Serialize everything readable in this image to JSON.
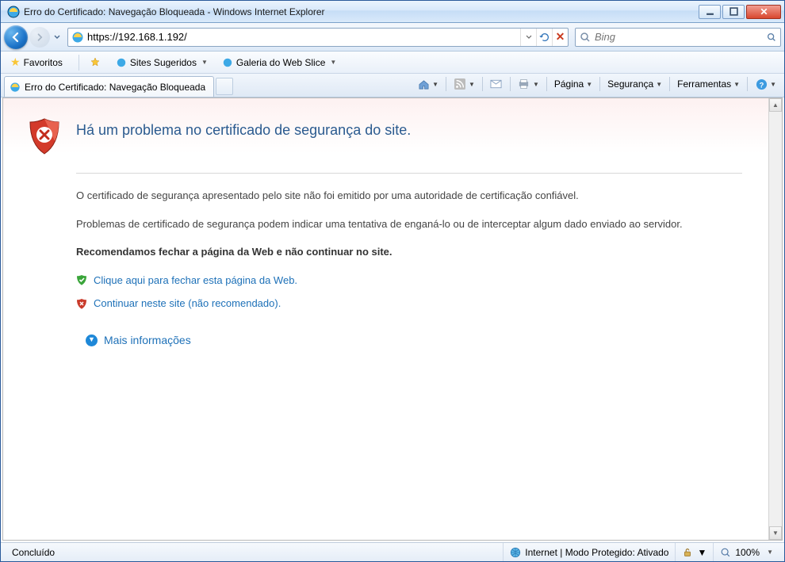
{
  "window": {
    "title": "Erro do Certificado: Navegação Bloqueada - Windows Internet Explorer"
  },
  "address": {
    "url": "https://192.168.1.192/"
  },
  "search": {
    "placeholder": "Bing"
  },
  "favorites": {
    "button": "Favoritos",
    "links": [
      {
        "label": "Sites Sugeridos"
      },
      {
        "label": "Galeria do Web Slice"
      }
    ]
  },
  "tab": {
    "title": "Erro do Certificado: Navegação Bloqueada"
  },
  "commands": {
    "page": "Página",
    "security": "Segurança",
    "tools": "Ferramentas"
  },
  "error": {
    "heading": "Há um problema no certificado de segurança do site.",
    "line1": "O certificado de segurança apresentado pelo site não foi emitido por uma autoridade de certificação confiável.",
    "line2": "Problemas de certificado de segurança podem indicar uma tentativa de enganá-lo ou de interceptar algum dado enviado ao servidor.",
    "recommend": "Recomendamos fechar a página da Web e não continuar no site.",
    "close_link": "Clique aqui para fechar esta página da Web.",
    "continue_link": "Continuar neste site (não recomendado).",
    "more_info": "Mais informações"
  },
  "status": {
    "left": "Concluído",
    "zone": "Internet | Modo Protegido: Ativado",
    "zoom": "100%"
  }
}
